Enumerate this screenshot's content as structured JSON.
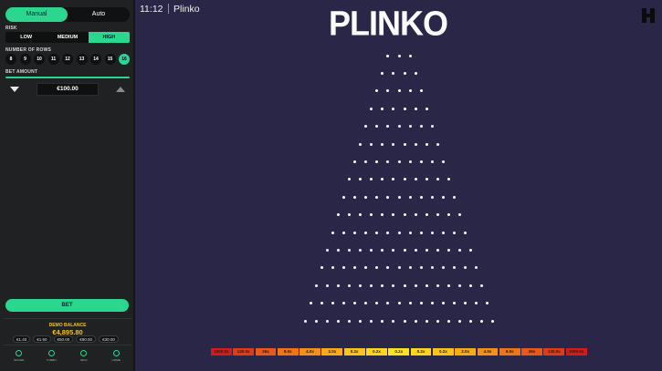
{
  "topbar": {
    "time": "11:12",
    "game_name": "Plinko",
    "logo_text": "PLINKO"
  },
  "panel": {
    "modes": [
      "Manual",
      "Auto"
    ],
    "active_mode": "Manual",
    "risk_label": "RISK",
    "risk_options": [
      "LOW",
      "MEDIUM",
      "HIGH"
    ],
    "active_risk": "HIGH",
    "rows_label": "NUMBER OF ROWS",
    "row_options": [
      "8",
      "9",
      "10",
      "11",
      "12",
      "13",
      "14",
      "15",
      "16"
    ],
    "active_row": "16",
    "bet_label": "BET AMOUNT",
    "bet_value": "€100.00",
    "bet_button": "BET",
    "balance_label": "DEMO BALANCE",
    "balance_value": "€4,895.80",
    "quick_bets": [
      "€1.40",
      "€1.60",
      "€50.00",
      "€90.00",
      "€30.00"
    ],
    "footer_items": [
      {
        "label": "SOUND",
        "icon": "sound-icon"
      },
      {
        "label": "TURBO",
        "icon": "turbo-icon"
      },
      {
        "label": "INFO",
        "icon": "info-icon"
      },
      {
        "label": "HOME",
        "icon": "home-icon"
      }
    ]
  },
  "board": {
    "peg_rows": 16,
    "top_row_pegs": 3,
    "multipliers": [
      "1000.0x",
      "130.0x",
      "26x",
      "9.0x",
      "4.0x",
      "2.0x",
      "0.2x",
      "0.2x",
      "0.2x",
      "0.2x",
      "0.2x",
      "2.0x",
      "4.0x",
      "9.0x",
      "26x",
      "130.0x",
      "1000.0x"
    ],
    "slot_colors": [
      "#d41b1b",
      "#e23a16",
      "#ea5716",
      "#f07316",
      "#f48f17",
      "#f8aa17",
      "#fbc219",
      "#fdd51b",
      "#fee21c",
      "#fdd51b",
      "#fbc219",
      "#f8aa17",
      "#f48f17",
      "#f07316",
      "#ea5716",
      "#e23a16",
      "#d41b1b"
    ],
    "peg_color": "#ffffff",
    "background": "#2a2648"
  },
  "colors": {
    "accent": "#2bd68f",
    "balance": "#f2c21b"
  }
}
